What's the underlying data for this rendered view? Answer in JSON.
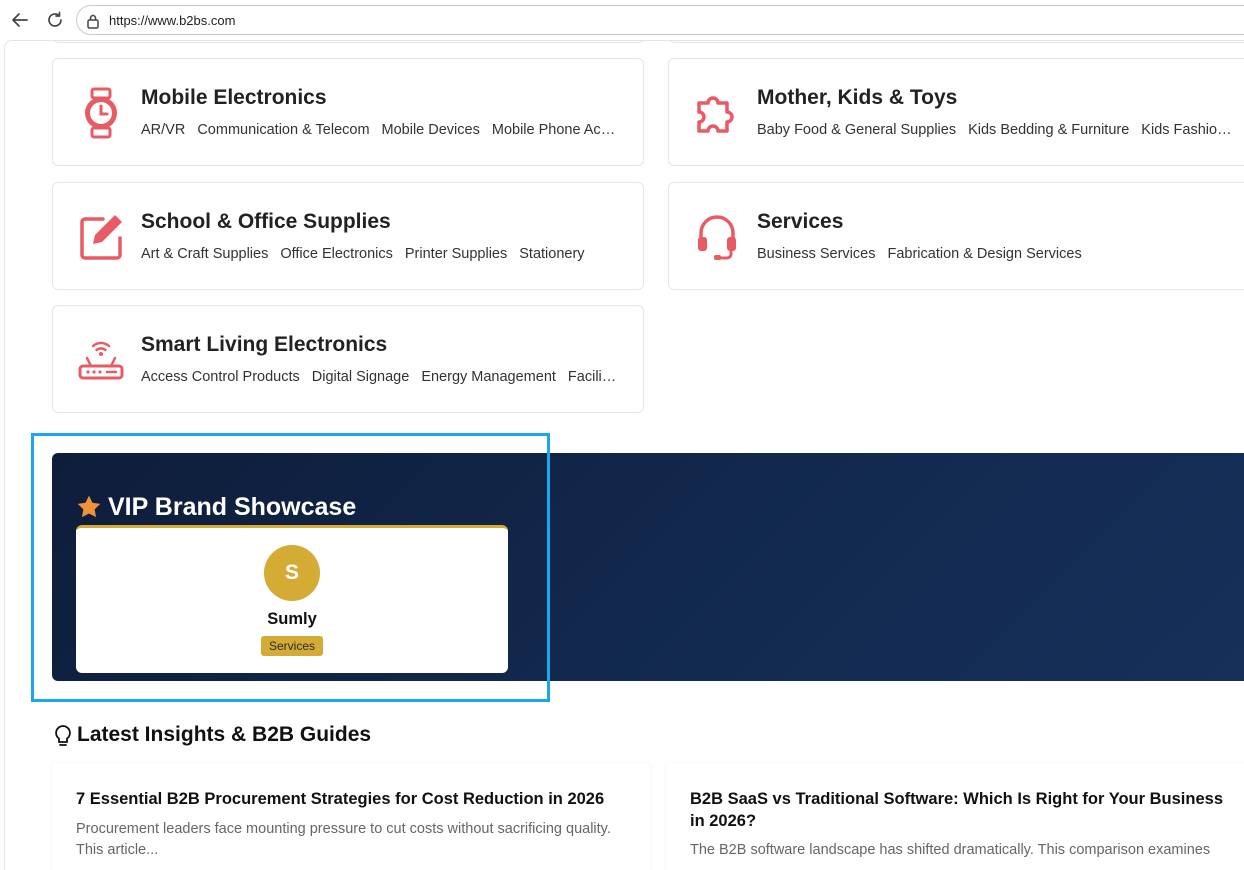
{
  "browser": {
    "url": "https://www.b2bs.com"
  },
  "categories": [
    {
      "title": "Mobile Electronics",
      "icon": "watch-icon",
      "subs": [
        "AR/VR",
        "Communication & Telecom",
        "Mobile Devices",
        "Mobile Phone Accessories"
      ]
    },
    {
      "title": "Mother, Kids & Toys",
      "icon": "puzzle-icon",
      "subs": [
        "Baby Food & General Supplies",
        "Kids Bedding & Furniture",
        "Kids Fashion"
      ]
    },
    {
      "title": "School & Office Supplies",
      "icon": "edit-icon",
      "subs": [
        "Art & Craft Supplies",
        "Office Electronics",
        "Printer Supplies",
        "Stationery"
      ]
    },
    {
      "title": "Services",
      "icon": "headset-icon",
      "subs": [
        "Business Services",
        "Fabrication & Design Services"
      ]
    },
    {
      "title": "Smart Living Electronics",
      "icon": "router-icon",
      "subs": [
        "Access Control Products",
        "Digital Signage",
        "Energy Management",
        "Facility Management"
      ]
    }
  ],
  "vip": {
    "title": "VIP Brand Showcase",
    "brand": {
      "initial": "S",
      "name": "Sumly",
      "tag": "Services"
    }
  },
  "insights": {
    "title": "Latest Insights & B2B Guides",
    "articles": [
      {
        "title": "7 Essential B2B Procurement Strategies for Cost Reduction in 2026",
        "desc": "Procurement leaders face mounting pressure to cut costs without sacrificing quality. This article..."
      },
      {
        "title": "B2B SaaS vs Traditional Software: Which Is Right for Your Business in 2026?",
        "desc": "The B2B software landscape has shifted dramatically. This comparison examines"
      }
    ]
  },
  "colors": {
    "accent": "#e85a64",
    "gold": "#d4ab35",
    "vip_bg": "#0e1d3a",
    "highlight": "#1aa7ee"
  }
}
